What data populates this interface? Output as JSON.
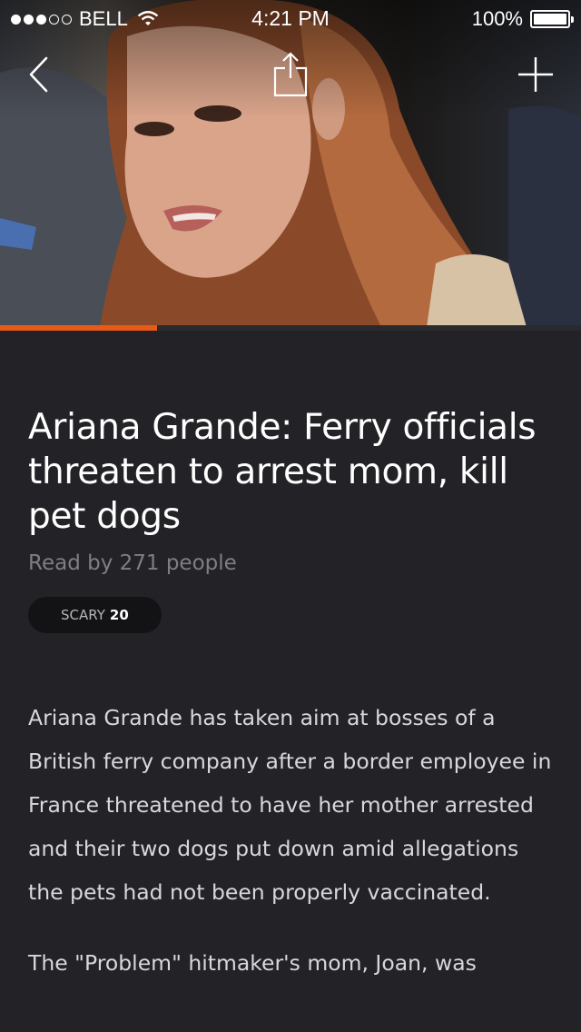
{
  "status_bar": {
    "carrier": "BELL",
    "time": "4:21 PM",
    "battery": "100%",
    "signal_bars_on": 3,
    "signal_bars_total": 5
  },
  "nav": {
    "back_icon": "chevron-left-icon",
    "share_icon": "share-icon",
    "add_icon": "plus-icon"
  },
  "reading_progress": 0.27,
  "colors": {
    "accent": "#ea5a17",
    "background": "#232327",
    "pill_background": "#131316"
  },
  "article": {
    "title": "Ariana Grande: Ferry officials threaten to arrest mom, kill pet dogs",
    "read_by": "Read by 271 people",
    "reaction": {
      "label": "SCARY",
      "count": "20"
    },
    "paragraphs": [
      "Ariana Grande has taken aim at bosses of a British ferry company after a border employee in France threatened to have her mother arrested and their two dogs put down amid allegations the pets had not been properly vaccinated.",
      "The \"Problem\" hitmaker's mom, Joan, was"
    ]
  }
}
